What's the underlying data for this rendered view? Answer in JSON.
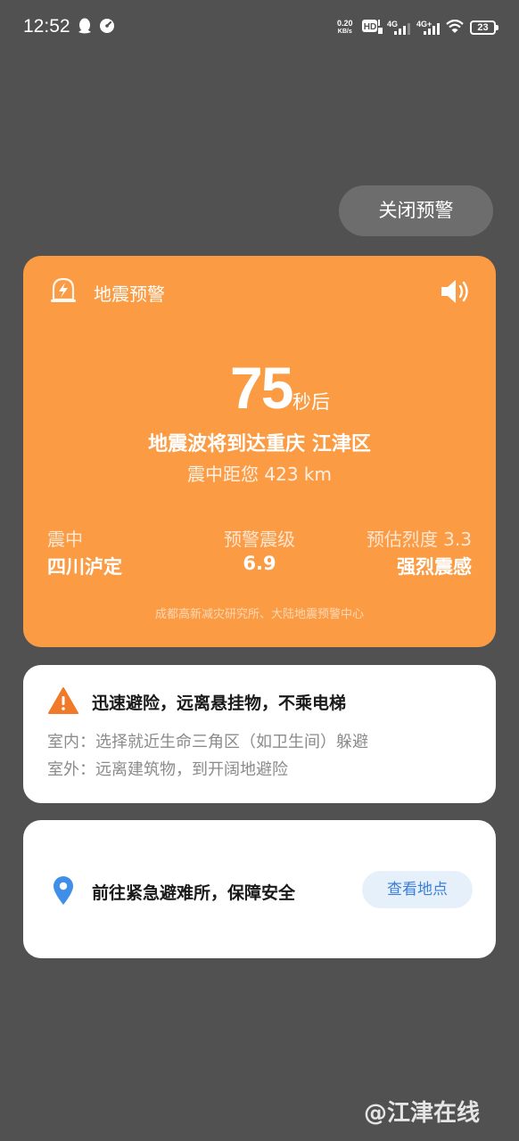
{
  "status_bar": {
    "time": "12:52",
    "net_speed_value": "0.20",
    "net_speed_unit": "KB/s",
    "battery": "23"
  },
  "close_button": {
    "label": "关闭预警"
  },
  "alert": {
    "title": "地震预警",
    "countdown": "75",
    "countdown_unit": "秒后",
    "arrival_text": "地震波将到达重庆 江津区",
    "distance_text": "震中距您 423 km",
    "epicenter_label": "震中",
    "epicenter_value": "四川泸定",
    "magnitude_label": "预警震级",
    "magnitude_value": "6.9",
    "intensity_label": "预估烈度 3.3",
    "intensity_value": "强烈震感",
    "source": "成都高新减灾研究所、大陆地震预警中心",
    "color": "#fb9c45"
  },
  "advice": {
    "title": "迅速避险，远离悬挂物，不乘电梯",
    "indoor": "室内：选择就近生命三角区（如卫生间）躲避",
    "outdoor": "室外：远离建筑物，到开阔地避险",
    "warn_color": "#f07a2a"
  },
  "shelter": {
    "text": "前往紧急避难所，保障安全",
    "button_label": "查看地点",
    "pin_color": "#3f8ee8"
  },
  "watermark": "@江津在线"
}
